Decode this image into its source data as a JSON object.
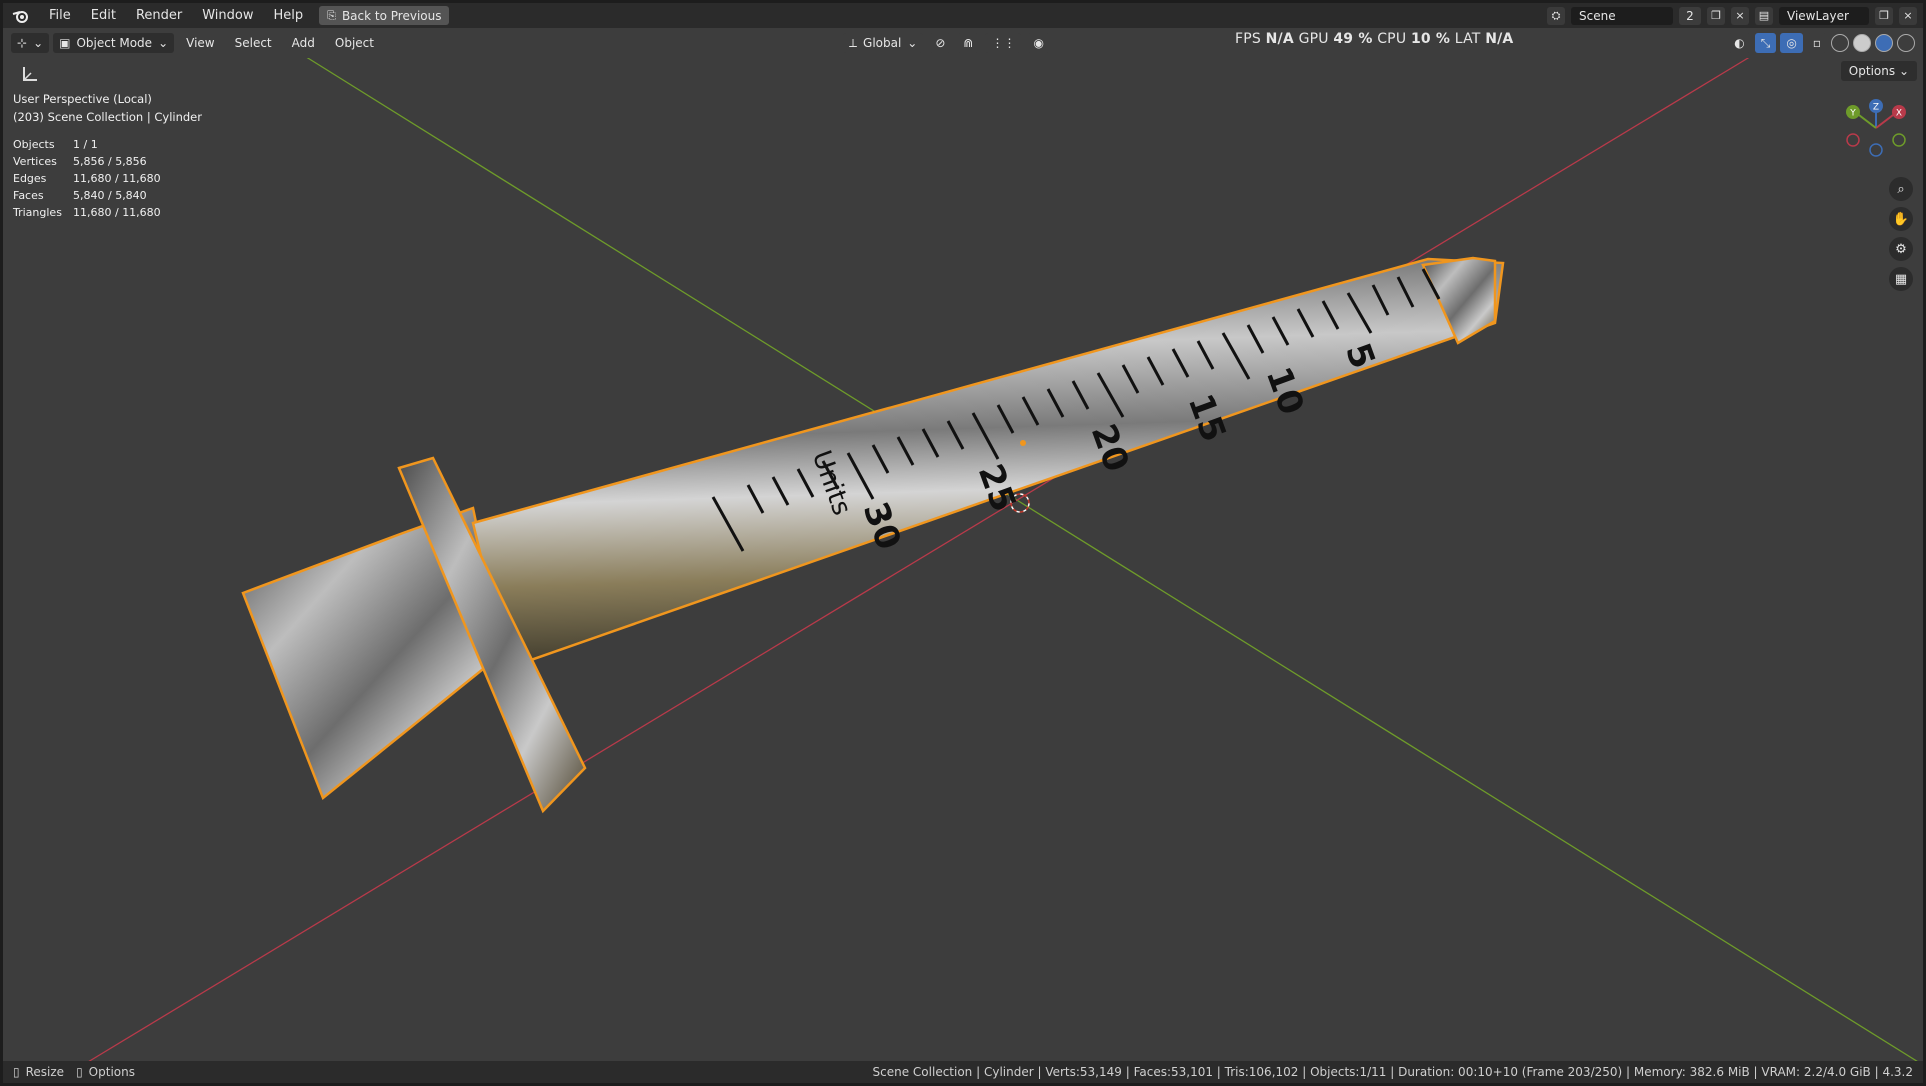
{
  "topbar": {
    "menus": [
      "File",
      "Edit",
      "Render",
      "Window",
      "Help"
    ],
    "back_button": "Back to Previous",
    "scene_label": "Scene",
    "scene_users": "2",
    "view_layer": "ViewLayer"
  },
  "header": {
    "mode": "Object Mode",
    "menus": [
      "View",
      "Select",
      "Add",
      "Object"
    ],
    "transform_orientation": "Global",
    "options_label": "Options"
  },
  "perf": {
    "fps_label": "FPS",
    "fps_value": "N/A",
    "gpu_label": "GPU",
    "gpu_value": "49 %",
    "cpu_label": "CPU",
    "cpu_value": "10 %",
    "lat_label": "LAT",
    "lat_value": "N/A"
  },
  "viewport_info": {
    "view_name": "User Perspective (Local)",
    "context": "(203) Scene Collection | Cylinder",
    "stats": [
      {
        "key": "Objects",
        "value": "1 / 1"
      },
      {
        "key": "Vertices",
        "value": "5,856 / 5,856"
      },
      {
        "key": "Edges",
        "value": "11,680 / 11,680"
      },
      {
        "key": "Faces",
        "value": "5,840 / 5,840"
      },
      {
        "key": "Triangles",
        "value": "11,680 / 11,680"
      }
    ]
  },
  "syringe_labels": [
    "5",
    "10",
    "15",
    "20",
    "25",
    "30",
    "Units"
  ],
  "gizmo_axes": {
    "x": "X",
    "y": "Y",
    "z": "Z"
  },
  "statusbar": {
    "resize": "Resize",
    "options": "Options",
    "summary": "Scene Collection | Cylinder | Verts:53,149 | Faces:53,101 | Tris:106,102 | Objects:1/11 | Duration: 00:10+10 (Frame 203/250) | Memory: 382.6 MiB | VRAM: 2.2/4.0 GiB | 4.3.2"
  },
  "colors": {
    "bg": "#3d3d3d",
    "bar": "#2b2b2b",
    "x_axis": "#b83a4a",
    "y_axis": "#6e9b2a",
    "selection": "#f0961e"
  }
}
